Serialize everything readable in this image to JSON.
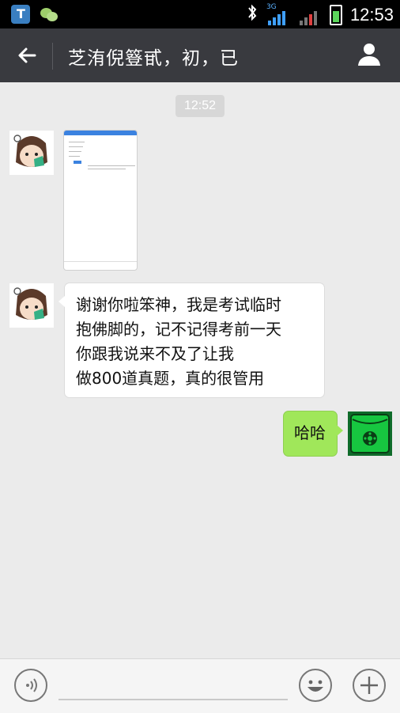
{
  "status_bar": {
    "network_label": "3G",
    "time": "12:53"
  },
  "header": {
    "back_icon": "arrow-left",
    "title": "芝洧倪簦甙，初，已",
    "profile_icon": "person-icon"
  },
  "chat": {
    "timestamp": "12:52",
    "messages": [
      {
        "side": "left",
        "type": "image",
        "content": ""
      },
      {
        "side": "left",
        "type": "text",
        "lines": [
          "谢谢你啦笨神，我是考试临时",
          "抱佛脚的，记不记得考前一天",
          "你跟我说来不及了让我",
          "做800道真题，真的很管用"
        ]
      },
      {
        "side": "right",
        "type": "text",
        "content": "哈哈"
      }
    ]
  },
  "input_bar": {
    "voice_icon": "voice-icon",
    "emoji_icon": "emoji-icon",
    "plus_icon": "plus-icon",
    "placeholder": ""
  },
  "colors": {
    "header_bg": "#393a3f",
    "chat_bg": "#ebebeb",
    "self_bubble": "#a0e75a"
  }
}
